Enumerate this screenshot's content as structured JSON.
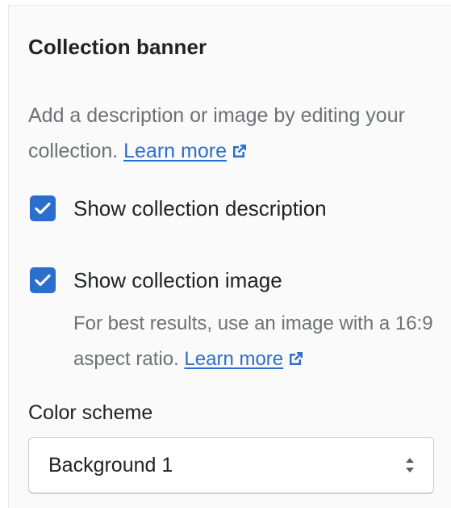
{
  "section": {
    "title": "Collection banner",
    "description": "Add a description or image by editing your collection.",
    "description_link": "Learn more"
  },
  "options": [
    {
      "label": "Show collection description",
      "checked": true
    },
    {
      "label": "Show collection image",
      "checked": true
    }
  ],
  "image_help": {
    "text": "For best results, use an image with a 16:9 aspect ratio.",
    "link": "Learn more"
  },
  "color_scheme": {
    "label": "Color scheme",
    "value": "Background 1"
  },
  "icons": {
    "external_link": "external-link-icon",
    "checkmark": "checkmark-icon",
    "select_arrows": "select-arrows-icon"
  },
  "colors": {
    "accent": "#2c6ecb",
    "text": "#202223",
    "subdued": "#6d7175",
    "panel_bg": "#fafafa"
  }
}
